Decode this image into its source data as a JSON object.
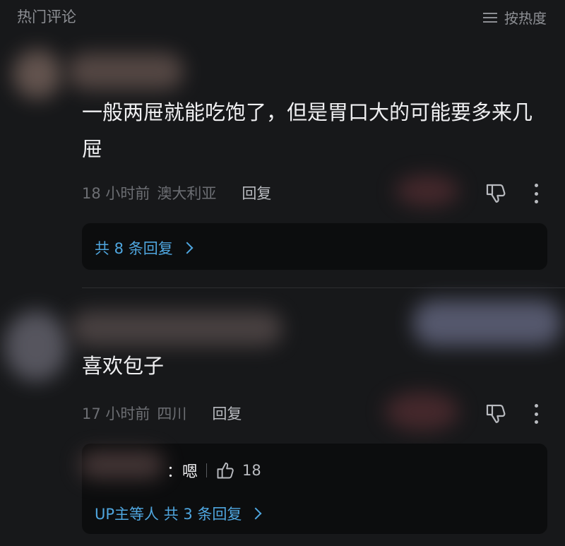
{
  "header": {
    "title": "热门评论",
    "sort_label": "按热度"
  },
  "comments": [
    {
      "text": "一般两屉就能吃饱了，但是胃口大的可能要多来几屉",
      "time": "18 小时前",
      "location": "澳大利亚",
      "reply_label": "回复",
      "replies_link": "共 8 条回复"
    },
    {
      "text": "喜欢包子",
      "time": "17 小时前",
      "location": "四川",
      "reply_label": "回复",
      "sub_reply": {
        "text": "：嗯",
        "likes": "18"
      },
      "replies_link": "UP主等人 共 3 条回复"
    }
  ],
  "colors": {
    "background": "#17181a",
    "link": "#4fa6df",
    "muted": "#6c6e73"
  }
}
